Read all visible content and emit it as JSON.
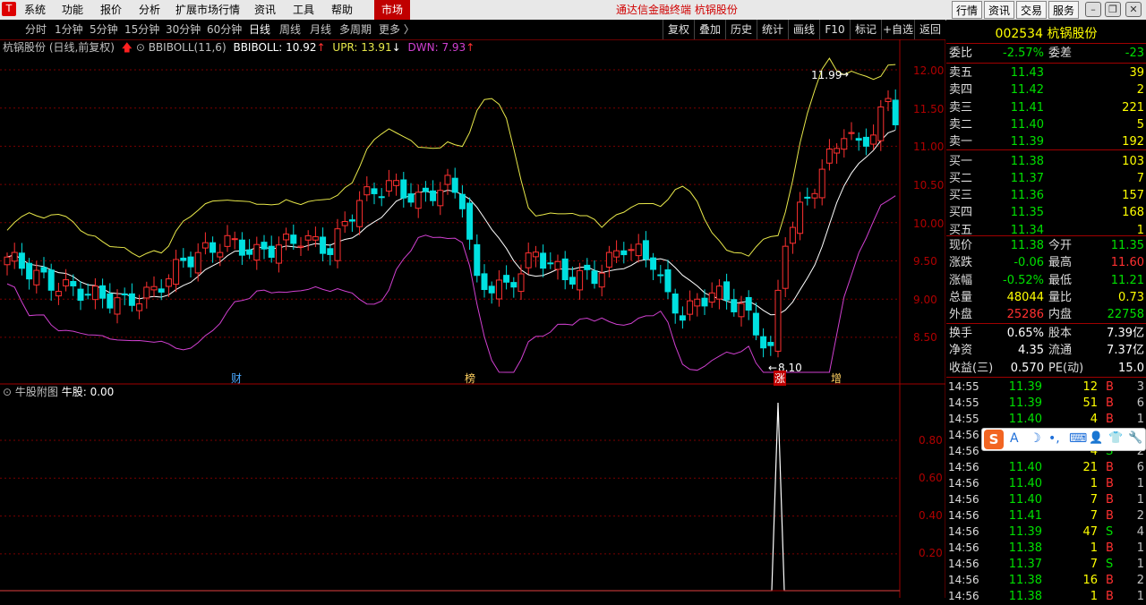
{
  "menubar": {
    "logo": "T",
    "items": [
      "系统",
      "功能",
      "报价",
      "分析",
      "扩展市场行情",
      "资讯",
      "工具",
      "帮助"
    ],
    "market": "市场",
    "app_title": "通达信金融终端  杭锅股份",
    "right_buttons": [
      "行情",
      "资讯",
      "交易",
      "服务"
    ]
  },
  "toolbar": {
    "periods": [
      "分时",
      "1分钟",
      "5分钟",
      "15分钟",
      "30分钟",
      "60分钟",
      "日线",
      "周线",
      "月线",
      "多周期",
      "更多 〉"
    ],
    "active_period": "日线",
    "tools": [
      "复权",
      "叠加",
      "历史",
      "统计",
      "画线",
      "F10",
      "标记",
      "+自选",
      "返回"
    ]
  },
  "main_chart": {
    "stock_label": "杭锅股份 (日线,前复权)",
    "indicator_name": "BBIBOLL(11,6)",
    "bbiboll_text": "BBIBOLL: 10.92",
    "upr_text": "UPR: 13.91",
    "dwn_text": "DWN: 7.93",
    "price_ticks": [
      "12.00",
      "11.50",
      "11.00",
      "10.50",
      "10.00",
      "9.50",
      "9.00",
      "8.50"
    ],
    "high_marker": "11.99",
    "low_marker": "8.10",
    "event_markers": [
      "财",
      "榜",
      "涨",
      "增"
    ],
    "colors": {
      "up": "#ff3030",
      "down": "#00e0e0",
      "mid": "#ffffff",
      "upper": "#e8e84a",
      "lower": "#d040d0"
    }
  },
  "sub_chart": {
    "title": "牛股附图",
    "value_text": "牛股: 0.00",
    "ticks": [
      "0.80",
      "0.60",
      "0.40",
      "0.20"
    ]
  },
  "quote_panel": {
    "code": "002534",
    "name": "杭锅股份",
    "weibi_label": "委比",
    "weibi_value": "-2.57%",
    "weicha_label": "委差",
    "weicha_value": "-23",
    "asks": [
      {
        "label": "卖五",
        "price": "11.43",
        "vol": "39"
      },
      {
        "label": "卖四",
        "price": "11.42",
        "vol": "2"
      },
      {
        "label": "卖三",
        "price": "11.41",
        "vol": "221"
      },
      {
        "label": "卖二",
        "price": "11.40",
        "vol": "5"
      },
      {
        "label": "卖一",
        "price": "11.39",
        "vol": "192"
      }
    ],
    "bids": [
      {
        "label": "买一",
        "price": "11.38",
        "vol": "103"
      },
      {
        "label": "买二",
        "price": "11.37",
        "vol": "7"
      },
      {
        "label": "买三",
        "price": "11.36",
        "vol": "157"
      },
      {
        "label": "买四",
        "price": "11.35",
        "vol": "168"
      },
      {
        "label": "买五",
        "price": "11.34",
        "vol": "1"
      }
    ],
    "stats": [
      {
        "l1": "现价",
        "v1": "11.38",
        "c1": "green",
        "l2": "今开",
        "v2": "11.35",
        "c2": "green"
      },
      {
        "l1": "涨跌",
        "v1": "-0.06",
        "c1": "green",
        "l2": "最高",
        "v2": "11.60",
        "c2": "red"
      },
      {
        "l1": "涨幅",
        "v1": "-0.52%",
        "c1": "green",
        "l2": "最低",
        "v2": "11.21",
        "c2": "green"
      },
      {
        "l1": "总量",
        "v1": "48044",
        "c1": "yellow",
        "l2": "量比",
        "v2": "0.73",
        "c2": "yellow"
      },
      {
        "l1": "外盘",
        "v1": "25286",
        "c1": "red",
        "l2": "内盘",
        "v2": "22758",
        "c2": "green"
      }
    ],
    "stats2": [
      {
        "l1": "换手",
        "v1": "0.65%",
        "l2": "股本",
        "v2": "7.39亿"
      },
      {
        "l1": "净资",
        "v1": "4.35",
        "l2": "流通",
        "v2": "7.37亿"
      },
      {
        "l1": "收益(三)",
        "v1": "0.570",
        "l2": "PE(动)",
        "v2": "15.0"
      }
    ],
    "ticks": [
      {
        "time": "14:55",
        "price": "11.39",
        "pc": "green",
        "vol": "12",
        "bs": "B",
        "n": "3"
      },
      {
        "time": "14:55",
        "price": "11.39",
        "pc": "green",
        "vol": "51",
        "bs": "B",
        "n": "6"
      },
      {
        "time": "14:55",
        "price": "11.40",
        "pc": "green",
        "vol": "4",
        "bs": "B",
        "n": "1"
      },
      {
        "time": "14:56",
        "price": "",
        "pc": "green",
        "vol": "",
        "bs": "",
        "n": ""
      },
      {
        "time": "14:56",
        "price": "",
        "pc": "green",
        "vol": "4",
        "bs": "S",
        "n": "2"
      },
      {
        "time": "14:56",
        "price": "11.40",
        "pc": "green",
        "vol": "21",
        "bs": "B",
        "n": "6"
      },
      {
        "time": "14:56",
        "price": "11.40",
        "pc": "green",
        "vol": "1",
        "bs": "B",
        "n": "1"
      },
      {
        "time": "14:56",
        "price": "11.40",
        "pc": "green",
        "vol": "7",
        "bs": "B",
        "n": "1"
      },
      {
        "time": "14:56",
        "price": "11.41",
        "pc": "green",
        "vol": "7",
        "bs": "B",
        "n": "2"
      },
      {
        "time": "14:56",
        "price": "11.39",
        "pc": "green",
        "vol": "47",
        "bs": "S",
        "n": "4"
      },
      {
        "time": "14:56",
        "price": "11.38",
        "pc": "green",
        "vol": "1",
        "bs": "B",
        "n": "1"
      },
      {
        "time": "14:56",
        "price": "11.37",
        "pc": "green",
        "vol": "7",
        "bs": "S",
        "n": "1"
      },
      {
        "time": "14:56",
        "price": "11.38",
        "pc": "green",
        "vol": "16",
        "bs": "B",
        "n": "2"
      },
      {
        "time": "14:56",
        "price": "11.38",
        "pc": "green",
        "vol": "1",
        "bs": "B",
        "n": "1"
      }
    ]
  },
  "ime_toolbar": {
    "logo": "S",
    "items": [
      "A",
      "☽",
      "•,",
      "⌨",
      "👤",
      "👕",
      "🔧"
    ]
  }
}
